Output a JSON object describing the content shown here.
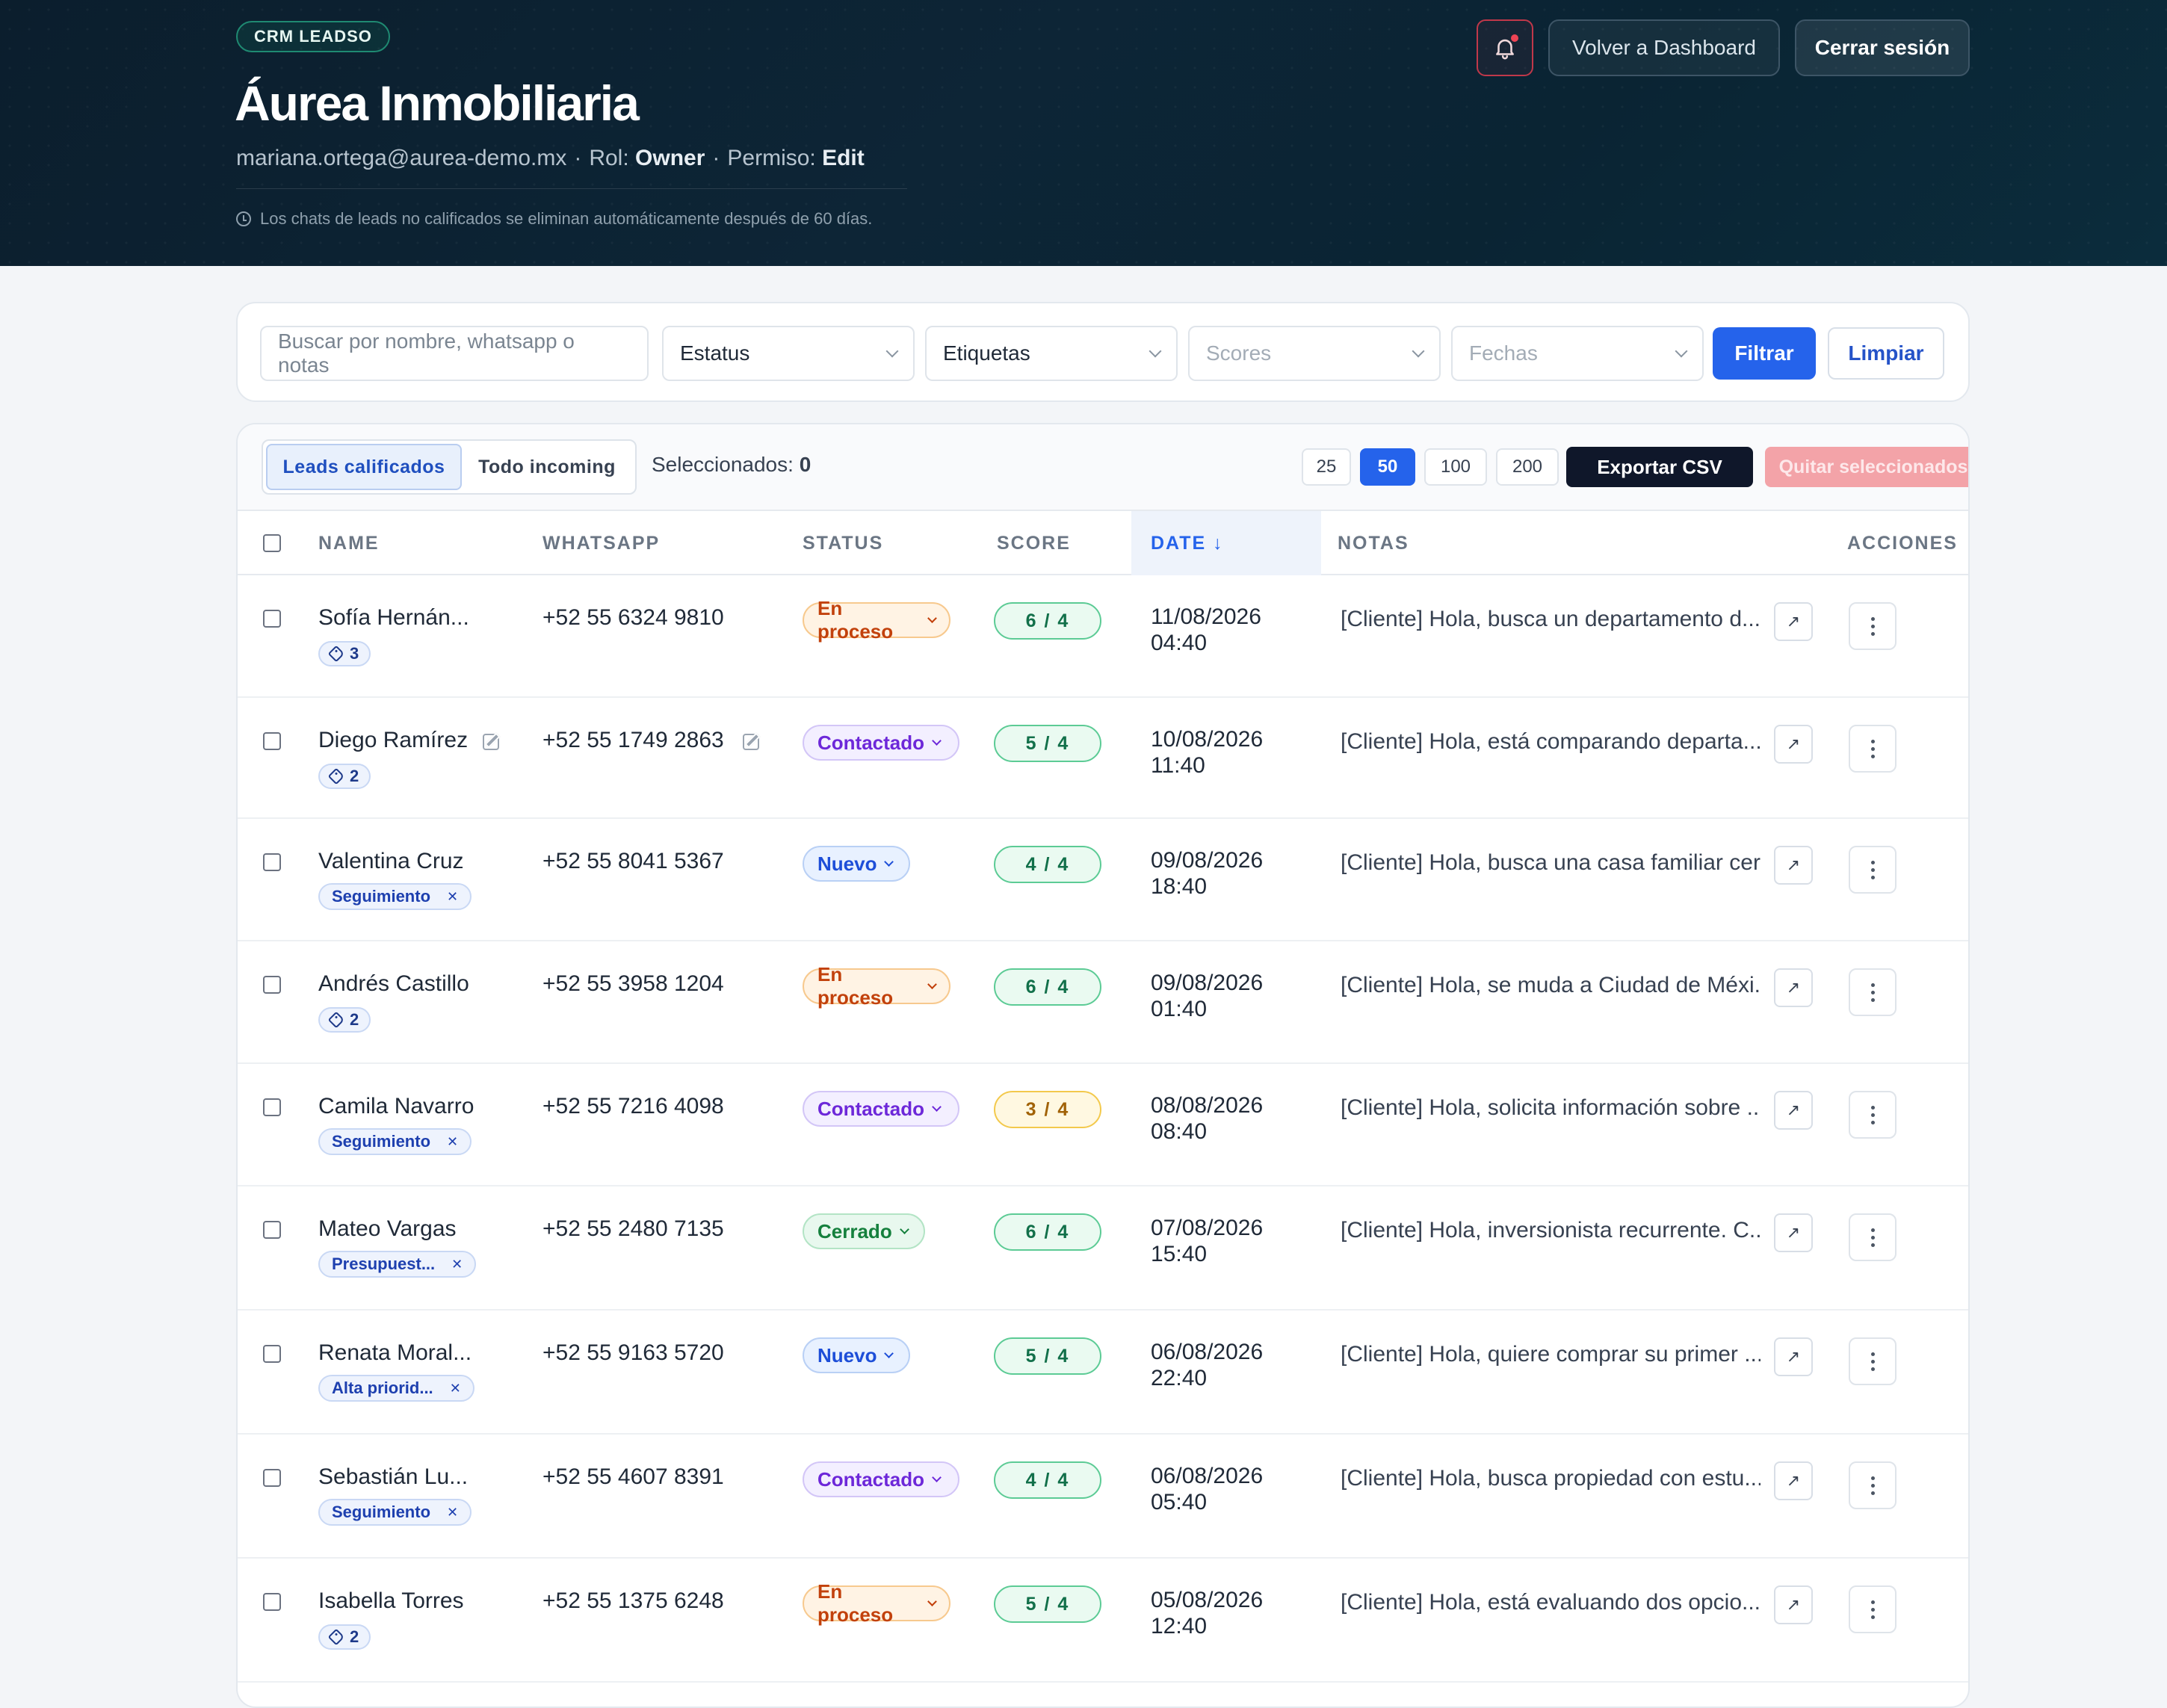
{
  "header": {
    "badge": "CRM LEADSO",
    "company": "Áurea Inmobiliaria",
    "email": "mariana.ortega@aurea-demo.mx",
    "sep": "·",
    "role_label": "Rol:",
    "role": "Owner",
    "perm_label": "Permiso:",
    "perm": "Edit",
    "notice": "Los chats de leads no calificados se eliminan automáticamente después de 60 días.",
    "dashboard_btn": "Volver a Dashboard",
    "logout_btn": "Cerrar sesión"
  },
  "filters": {
    "search_placeholder": "Buscar por nombre, whatsapp o notas",
    "status": "Estatus",
    "tags": "Etiquetas",
    "scores": "Scores",
    "dates": "Fechas",
    "apply": "Filtrar",
    "clear": "Limpiar"
  },
  "toolbar": {
    "tab_qualified": "Leads calificados",
    "tab_all": "Todo incoming",
    "selected_label": "Seleccionados:",
    "selected_count": "0",
    "page_sizes": [
      "25",
      "50",
      "100",
      "200"
    ],
    "active_page_size": "50",
    "export": "Exportar CSV",
    "remove": "Quitar seleccionados"
  },
  "columns": {
    "name": "NAME",
    "whatsapp": "WHATSAPP",
    "status": "STATUS",
    "score": "SCORE",
    "date": "DATE ↓",
    "notes": "NOTAS",
    "actions": "ACCIONES"
  },
  "rows": [
    {
      "name": "Sofía Hernán...",
      "tag_count": "3",
      "phone": "+52 55 6324 9810",
      "status": "En proceso",
      "status_kind": "proceso",
      "score": "6 / 4",
      "score_kind": "green",
      "date": "11/08/2026",
      "time": "04:40",
      "note": "[Cliente] Hola, busca un departamento d..."
    },
    {
      "name": "Diego Ramírez",
      "tag_count": "2",
      "edit": true,
      "phone": "+52 55 1749 2863",
      "status": "Contactado",
      "status_kind": "contactado",
      "score": "5 / 4",
      "score_kind": "green",
      "date": "10/08/2026",
      "time": "11:40",
      "note": "[Cliente] Hola, está comparando departa..."
    },
    {
      "name": "Valentina Cruz",
      "tag": "Seguimiento",
      "phone": "+52 55 8041 5367",
      "status": "Nuevo",
      "status_kind": "nuevo",
      "score": "4 / 4",
      "score_kind": "green",
      "date": "09/08/2026",
      "time": "18:40",
      "note": "[Cliente] Hola, busca una casa familiar cer..."
    },
    {
      "name": "Andrés Castillo",
      "tag_count": "2",
      "phone": "+52 55 3958 1204",
      "status": "En proceso",
      "status_kind": "proceso",
      "score": "6 / 4",
      "score_kind": "green",
      "date": "09/08/2026",
      "time": "01:40",
      "note": "[Cliente] Hola, se muda a Ciudad de Méxi..."
    },
    {
      "name": "Camila Navarro",
      "tag": "Seguimiento",
      "phone": "+52 55 7216 4098",
      "status": "Contactado",
      "status_kind": "contactado",
      "score": "3 / 4",
      "score_kind": "yellow",
      "date": "08/08/2026",
      "time": "08:40",
      "note": "[Cliente] Hola, solicita información sobre ..."
    },
    {
      "name": "Mateo Vargas",
      "tag": "Presupuest...",
      "phone": "+52 55 2480 7135",
      "status": "Cerrado",
      "status_kind": "cerrado",
      "score": "6 / 4",
      "score_kind": "green",
      "date": "07/08/2026",
      "time": "15:40",
      "note": "[Cliente] Hola, inversionista recurrente. C..."
    },
    {
      "name": "Renata Moral...",
      "tag": "Alta priorid...",
      "phone": "+52 55 9163 5720",
      "status": "Nuevo",
      "status_kind": "nuevo",
      "score": "5 / 4",
      "score_kind": "green",
      "date": "06/08/2026",
      "time": "22:40",
      "note": "[Cliente] Hola, quiere comprar su primer ..."
    },
    {
      "name": "Sebastián Lu...",
      "tag": "Seguimiento",
      "phone": "+52 55 4607 8391",
      "status": "Contactado",
      "status_kind": "contactado",
      "score": "4 / 4",
      "score_kind": "green",
      "date": "06/08/2026",
      "time": "05:40",
      "note": "[Cliente] Hola, busca propiedad con estu..."
    },
    {
      "name": "Isabella Torres",
      "tag_count": "2",
      "phone": "+52 55 1375 6248",
      "status": "En proceso",
      "status_kind": "proceso",
      "score": "5 / 4",
      "score_kind": "green",
      "date": "05/08/2026",
      "time": "12:40",
      "note": "[Cliente] Hola, está evaluando dos opcio..."
    }
  ]
}
